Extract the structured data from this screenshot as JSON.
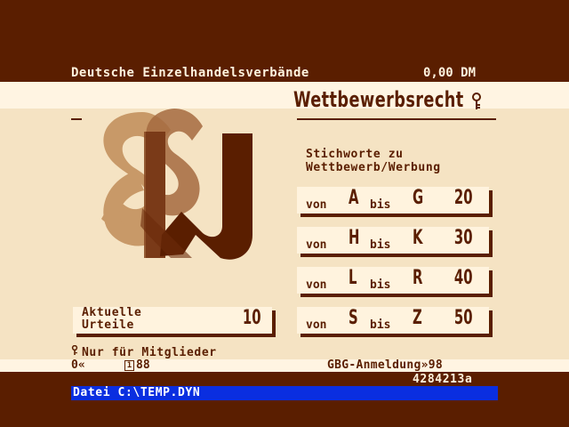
{
  "header": {
    "publisher": "Deutsche Einzelhandelsverbände",
    "price": "0,00 DM"
  },
  "page": {
    "title": "Wettbewerbsrecht",
    "title_icon": "key-icon",
    "logo_icon": "paragraph-law-logo-icon",
    "subtitle_line1": "Stichworte zu",
    "subtitle_line2": "Wettbewerb/Werbung"
  },
  "ranges": [
    {
      "von": "von",
      "from": "A",
      "bis": "bis",
      "to": "G",
      "page": "20"
    },
    {
      "von": "von",
      "from": "H",
      "bis": "bis",
      "to": "K",
      "page": "30"
    },
    {
      "von": "von",
      "from": "L",
      "bis": "bis",
      "to": "R",
      "page": "40"
    },
    {
      "von": "von",
      "from": "S",
      "bis": "bis",
      "to": "Z",
      "page": "50"
    }
  ],
  "urteile": {
    "line1": "Aktuelle",
    "line2": "Urteile",
    "page": "10"
  },
  "members_note": "Nur für Mitglieder",
  "nav": {
    "left": "0«",
    "page_icon_num": "1",
    "current": "88",
    "right": "GBG-Anmeldung»98"
  },
  "code": "4284213a",
  "status": {
    "file": "Datei C:\\TEMP.DYN"
  },
  "colors": {
    "background": "#5a1e00",
    "panel": "#f5e3c3",
    "stripe": "#fff4e2",
    "status_bar": "#0a2ee0"
  }
}
